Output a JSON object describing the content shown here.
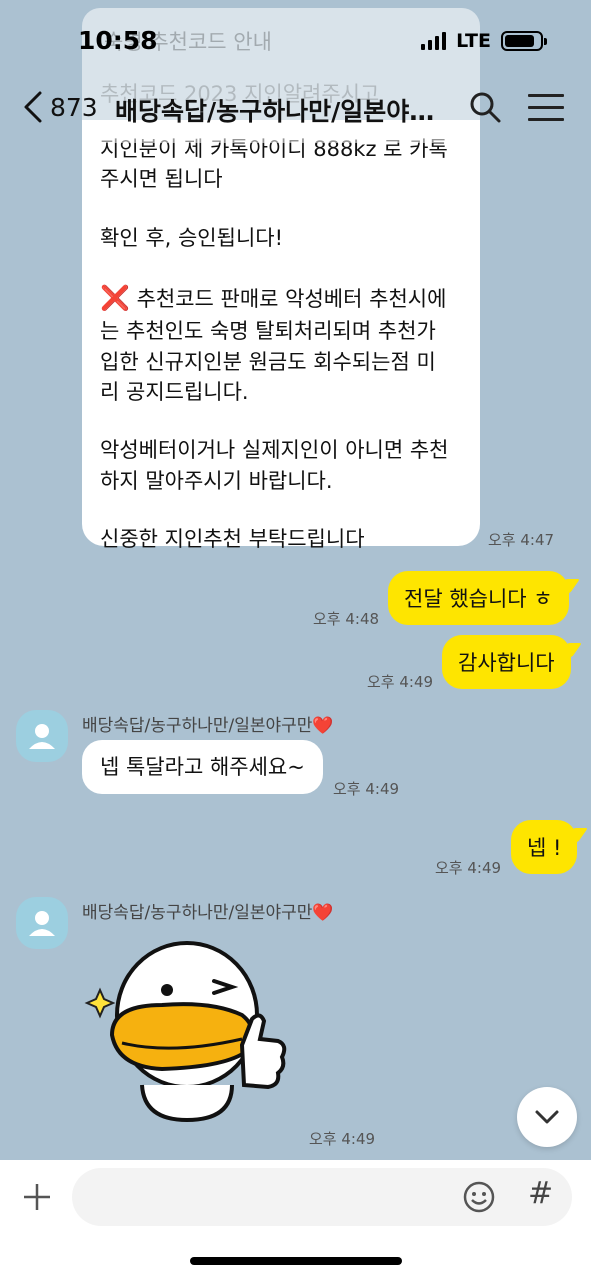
{
  "status_bar": {
    "time": "10:58",
    "network": "LTE"
  },
  "notice_ghost": {
    "title": "숙명 추천코드 안내",
    "line": "추천코드 2023 지인알려주시고"
  },
  "header": {
    "back_count": "873",
    "title": "배당속답/농구하나만/일본야구만",
    "icons": [
      "back-chevron-icon",
      "search-icon",
      "menu-icon"
    ]
  },
  "notice": {
    "paragraphs": [
      "지인분이 제 카톡아이디 888kz 로 카톡\n주시면 됩니다",
      "확인 후, 승인됩니다!",
      "추천코드 판매로 악성베터 추천시에\n는 추천인도 숙명 탈퇴처리되며 추천가\n입한 신규지인분 원금도 회수되는점 미\n리 공지드립니다.",
      "악성베터이거나 실제지인이 아니면 추천\n하지 말아주시기 바랍니다.",
      "신중한 지인추천 부탁드립니다"
    ],
    "x_mark": "❌",
    "time": "오후 4:47"
  },
  "messages": [
    {
      "text": "전달 했습니다 ㅎ",
      "time": "오후 4:48"
    },
    {
      "text": "감사합니다",
      "time": "오후 4:49"
    },
    {
      "sender": "배당속답/농구하나만/일본야구만",
      "heart": "❤️",
      "text": "넵 톡달라고 해주세요~",
      "time": "오후 4:49"
    },
    {
      "text": "넵 !",
      "time": "오후 4:49"
    },
    {
      "sender": "배당속답/농구하나만/일본야구만",
      "heart": "❤️",
      "sticker": "thumbs-up-duck-sticker",
      "time": "오후 4:49"
    }
  ],
  "input": {
    "placeholder": ""
  },
  "colors": {
    "background": "#abc1d1",
    "my_bubble": "#fee500",
    "their_bubble": "#ffffff",
    "accent_red": "#e0212a"
  }
}
